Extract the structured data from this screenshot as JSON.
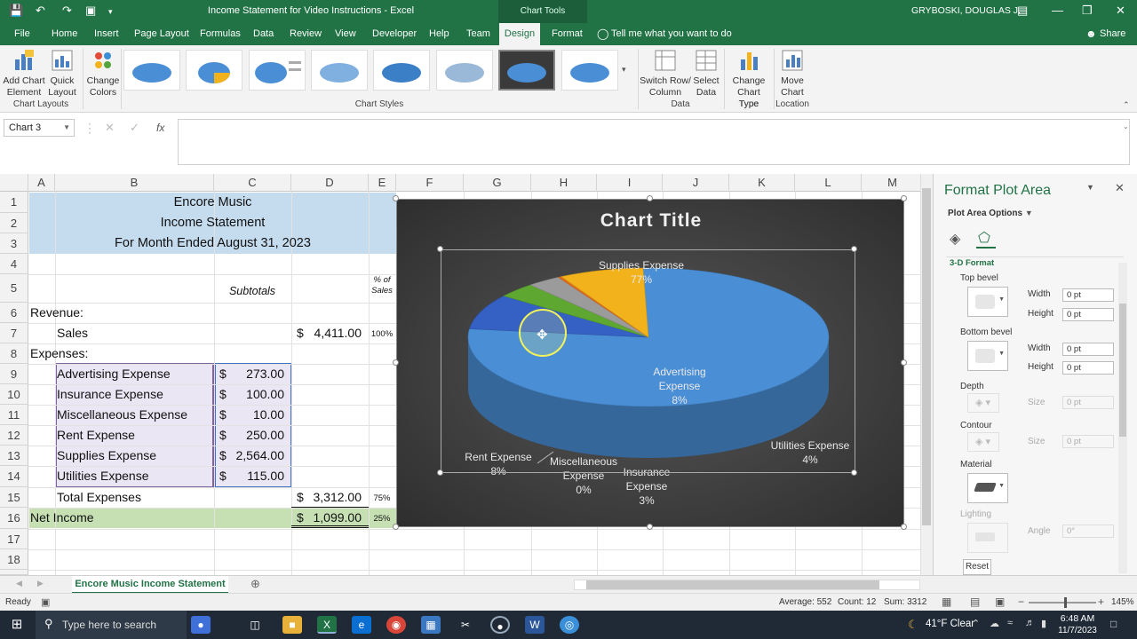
{
  "window": {
    "title": "Income Statement for Video Instructions  -  Excel",
    "context_tab": "Chart Tools",
    "user": "GRYBOSKI, DOUGLAS J."
  },
  "tabs": [
    "File",
    "Home",
    "Insert",
    "Page Layout",
    "Formulas",
    "Data",
    "Review",
    "View",
    "Developer",
    "Help",
    "Team",
    "Design",
    "Format"
  ],
  "tell_me": "Tell me what you want to do",
  "share": "Share",
  "ribbon": {
    "add_chart_element": "Add Chart Element",
    "quick_layout": "Quick Layout",
    "change_colors": "Change Colors",
    "group_chart_layouts": "Chart Layouts",
    "group_chart_styles": "Chart Styles",
    "switch_row_column": "Switch Row/ Column",
    "select_data": "Select Data",
    "group_data": "Data",
    "change_chart_type": "Change Chart Type",
    "group_type": "Type",
    "move_chart": "Move Chart",
    "group_location": "Location"
  },
  "name_box": "Chart 3",
  "fx": "fx",
  "columns": [
    "A",
    "B",
    "C",
    "D",
    "E",
    "F",
    "G",
    "H",
    "I",
    "J",
    "K",
    "L",
    "M"
  ],
  "rows": [
    "1",
    "2",
    "3",
    "4",
    "5",
    "6",
    "7",
    "8",
    "9",
    "10",
    "11",
    "12",
    "13",
    "14",
    "15",
    "16",
    "17",
    "18"
  ],
  "sheet": {
    "company": "Encore Music",
    "statement": "Income Statement",
    "period": "For Month Ended August 31, 2023",
    "subtotals": "Subtotals",
    "pct_header_1": "% of",
    "pct_header_2": "Sales",
    "revenue_label": "Revenue:",
    "sales_label": "Sales",
    "sales_amount": "4,411.00",
    "sales_pct": "100%",
    "expenses_label": "Expenses:",
    "expenses": [
      {
        "name": "Advertising Expense",
        "amount": "273.00"
      },
      {
        "name": "Insurance Expense",
        "amount": "100.00"
      },
      {
        "name": "Miscellaneous Expense",
        "amount": "10.00"
      },
      {
        "name": "Rent Expense",
        "amount": "250.00"
      },
      {
        "name": "Supplies Expense",
        "amount": "2,564.00"
      },
      {
        "name": "Utilities Expense",
        "amount": "115.00"
      }
    ],
    "dollar": "$",
    "total_expenses_label": "Total Expenses",
    "total_expenses_amount": "3,312.00",
    "total_expenses_pct": "75%",
    "net_income_label": "Net Income",
    "net_income_amount": "1,099.00",
    "net_income_pct": "25%"
  },
  "chart_data": {
    "type": "pie",
    "title": "Chart Title",
    "categories": [
      "Supplies Expense",
      "Advertising Expense",
      "Utilities Expense",
      "Insurance Expense",
      "Miscellaneous Expense",
      "Rent Expense"
    ],
    "values": [
      2564,
      273,
      115,
      100,
      10,
      250
    ],
    "percent_labels": [
      "77%",
      "8%",
      "4%",
      "3%",
      "0%",
      "8%"
    ],
    "label_lines": [
      [
        "Supplies Expense",
        "77%"
      ],
      [
        "Advertising",
        "Expense",
        "8%"
      ],
      [
        "Utilities Expense",
        "4%"
      ],
      [
        "Insurance",
        "Expense",
        "3%"
      ],
      [
        "Miscellaneous",
        "Expense",
        "0%"
      ],
      [
        "Rent Expense",
        "8%"
      ]
    ],
    "colors": [
      "#4a8fd6",
      "#3561c4",
      "#5ea832",
      "#9b9b9b",
      "#e36c1c",
      "#f1b21b"
    ],
    "style": "3-D pie, dark background"
  },
  "pane": {
    "title": "Format Plot Area",
    "options": "Plot Area Options",
    "section": "3-D Format",
    "top_bevel": "Top bevel",
    "bottom_bevel": "Bottom bevel",
    "width": "Width",
    "height": "Height",
    "pt_value": "0 pt",
    "depth": "Depth",
    "contour": "Contour",
    "size": "Size",
    "material": "Material",
    "lighting": "Lighting",
    "angle": "Angle",
    "angle_value": "0°",
    "reset": "Reset"
  },
  "sheet_tab": "Encore Music Income Statement",
  "status": {
    "ready": "Ready",
    "average": "Average: 552",
    "count": "Count: 12",
    "sum": "Sum: 3312",
    "zoom": "145%"
  },
  "taskbar": {
    "search_placeholder": "Type here to search",
    "weather": "41°F  Clear",
    "time": "6:48 AM",
    "date": "11/7/2023"
  }
}
